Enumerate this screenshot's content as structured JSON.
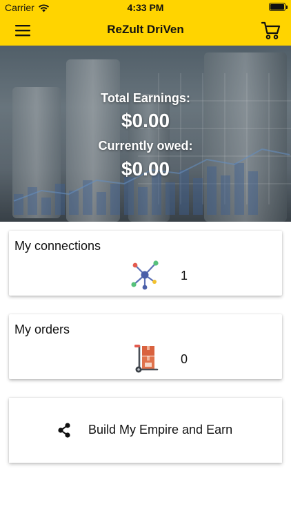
{
  "status_bar": {
    "carrier": "Carrier",
    "time": "4:33 PM"
  },
  "nav": {
    "title": "ReZult DriVen",
    "menu_icon": "hamburger-menu-icon",
    "cart_icon": "shopping-cart-icon"
  },
  "hero": {
    "total_label": "Total Earnings:",
    "total_value": "$0.00",
    "owed_label": "Currently owed:",
    "owed_value": "$0.00"
  },
  "connections": {
    "title": "My connections",
    "count": "1",
    "icon": "network-connections-icon"
  },
  "orders": {
    "title": "My orders",
    "count": "0",
    "icon": "hand-truck-boxes-icon"
  },
  "empire": {
    "label": "Build My Empire and Earn",
    "icon": "share-icon"
  },
  "colors": {
    "accent": "#FFD400",
    "text": "#111111"
  }
}
